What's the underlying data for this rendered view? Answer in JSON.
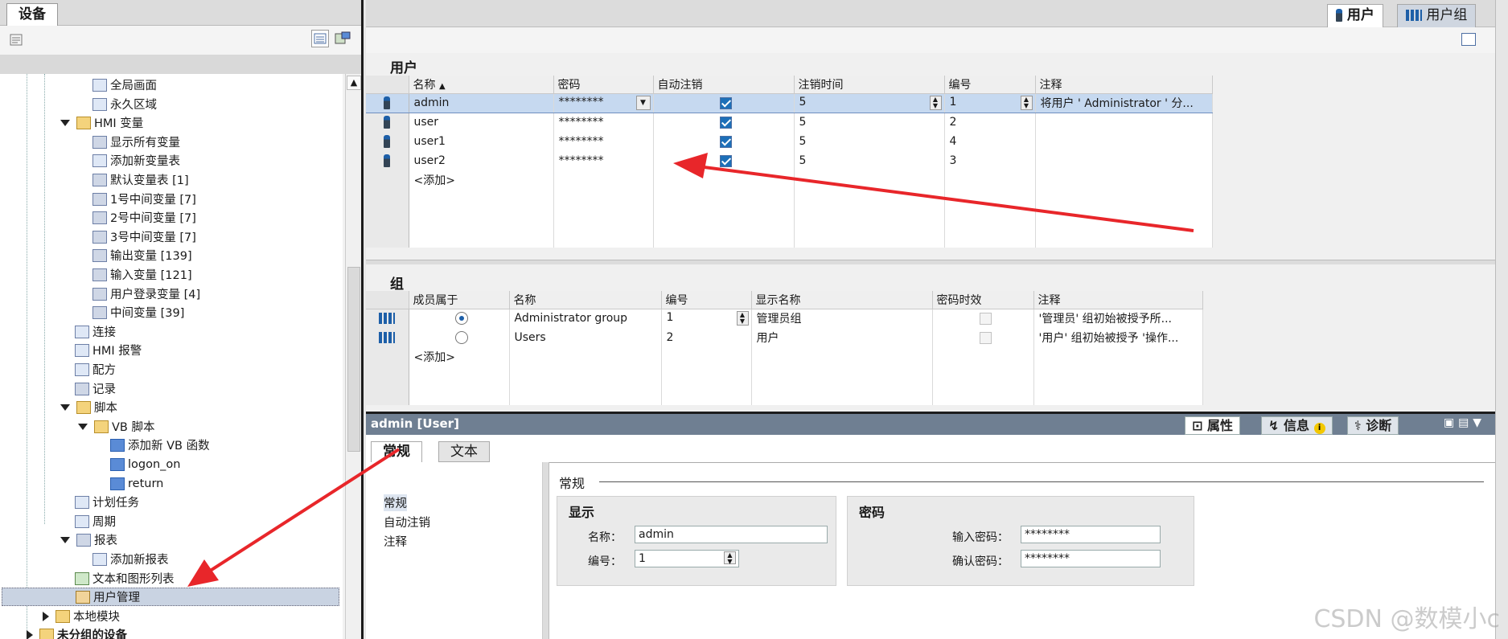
{
  "left_panel": {
    "tab": "设备",
    "tree": [
      {
        "label": "全局画面",
        "icon": "screen-icon"
      },
      {
        "label": "永久区域",
        "icon": "region-icon"
      },
      {
        "label": "HMI 变量",
        "icon": "folder-icon"
      },
      {
        "label": "显示所有变量",
        "icon": "tag-table-icon"
      },
      {
        "label": "添加新变量表",
        "icon": "add-tag-table-icon"
      },
      {
        "label": "默认变量表 [1]",
        "icon": "tag-table-icon"
      },
      {
        "label": "1号中间变量 [7]",
        "icon": "tag-table-icon"
      },
      {
        "label": "2号中间变量 [7]",
        "icon": "tag-table-icon"
      },
      {
        "label": "3号中间变量 [7]",
        "icon": "tag-table-icon"
      },
      {
        "label": "输出变量 [139]",
        "icon": "tag-table-icon"
      },
      {
        "label": "输入变量 [121]",
        "icon": "tag-table-icon"
      },
      {
        "label": "用户登录变量 [4]",
        "icon": "tag-table-icon"
      },
      {
        "label": "中间变量 [39]",
        "icon": "tag-table-icon"
      },
      {
        "label": "连接",
        "icon": "connection-icon"
      },
      {
        "label": "HMI 报警",
        "icon": "alarm-icon"
      },
      {
        "label": "配方",
        "icon": "recipe-icon"
      },
      {
        "label": "记录",
        "icon": "log-icon"
      },
      {
        "label": "脚本",
        "icon": "script-icon"
      },
      {
        "label": "VB 脚本",
        "icon": "vb-folder-icon"
      },
      {
        "label": "添加新 VB 函数",
        "icon": "add-vb-icon"
      },
      {
        "label": "logon_on",
        "icon": "vb-script-icon"
      },
      {
        "label": "return",
        "icon": "vb-script-icon"
      },
      {
        "label": "计划任务",
        "icon": "scheduler-icon"
      },
      {
        "label": "周期",
        "icon": "cycle-icon"
      },
      {
        "label": "报表",
        "icon": "report-icon"
      },
      {
        "label": "添加新报表",
        "icon": "add-report-icon"
      },
      {
        "label": "文本和图形列表",
        "icon": "text-graphic-list-icon"
      },
      {
        "label": "用户管理",
        "icon": "user-admin-icon"
      },
      {
        "label": "本地模块",
        "icon": "local-module-icon"
      },
      {
        "label": "未分组的设备",
        "icon": "device-group-icon"
      }
    ]
  },
  "editor": {
    "tab_users": "用户",
    "tab_groups": "用户组",
    "users_title": "用户",
    "users_columns": [
      "名称",
      "密码",
      "自动注销",
      "注销时间",
      "编号",
      "注释"
    ],
    "users": [
      {
        "name": "admin",
        "password": "********",
        "logoff": true,
        "time": "5",
        "number": "1",
        "comment": "将用户 ' Administrator ' 分..."
      },
      {
        "name": "user",
        "password": "********",
        "logoff": true,
        "time": "5",
        "number": "2",
        "comment": ""
      },
      {
        "name": "user1",
        "password": "********",
        "logoff": true,
        "time": "5",
        "number": "4",
        "comment": ""
      },
      {
        "name": "user2",
        "password": "********",
        "logoff": true,
        "time": "5",
        "number": "3",
        "comment": ""
      }
    ],
    "add_row": "<添加>",
    "groups_title": "组",
    "groups_columns": [
      "成员属于",
      "名称",
      "编号",
      "显示名称",
      "密码时效",
      "注释"
    ],
    "groups": [
      {
        "member": true,
        "name": "Administrator group",
        "number": "1",
        "display": "管理员组",
        "aging": false,
        "comment": "'管理员' 组初始被授予所..."
      },
      {
        "member": false,
        "name": "Users",
        "number": "2",
        "display": "用户",
        "aging": false,
        "comment": "'用户' 组初始被授予 '操作..."
      }
    ]
  },
  "properties": {
    "header": "admin [User]",
    "tab_props": "属性",
    "tab_info": "信息",
    "tab_diag": "诊断",
    "subtab_general": "常规",
    "subtab_text": "文本",
    "nav": [
      "常规",
      "自动注销",
      "注释"
    ],
    "section_title": "常规",
    "display_group": "显示",
    "name_label": "名称：",
    "name_value": "admin",
    "number_label": "编号：",
    "number_value": "1",
    "password_group": "密码",
    "enter_pw_label": "输入密码：",
    "enter_pw_value": "********",
    "confirm_pw_label": "确认密码：",
    "confirm_pw_value": "********"
  },
  "watermark": "CSDN @数模小c",
  "colors": {
    "arrow": "#e8262a",
    "selection": "#c6d9f0",
    "header_bar": "#6f7f92"
  }
}
